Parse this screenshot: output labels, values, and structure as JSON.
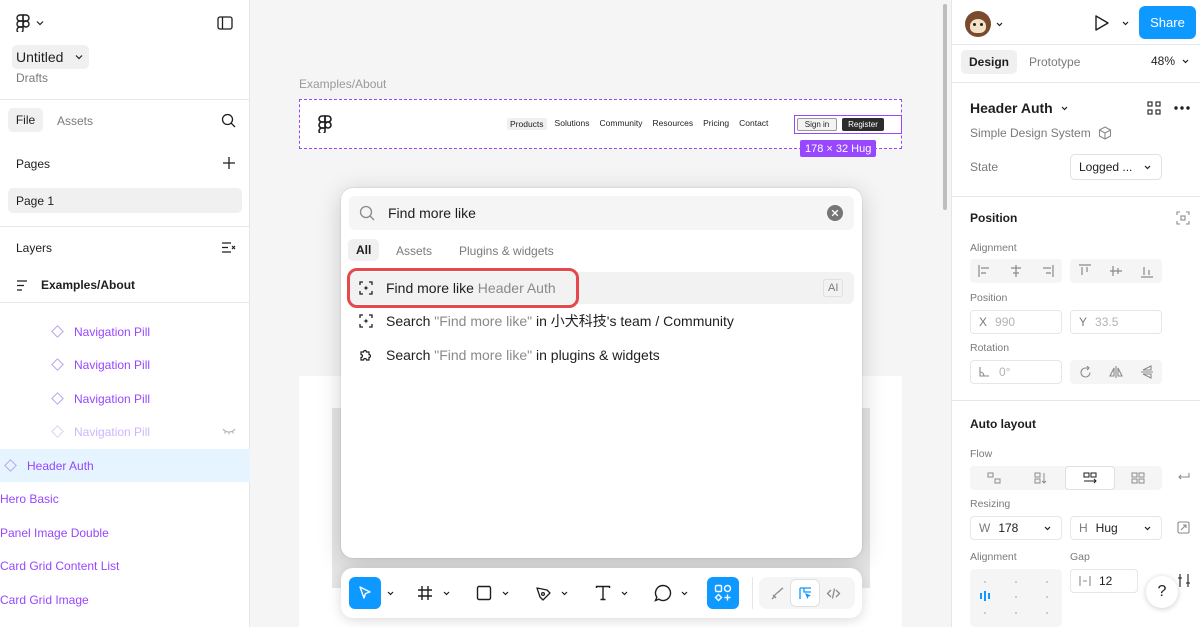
{
  "file": {
    "name": "Untitled",
    "location": "Drafts"
  },
  "left_tabs": {
    "file": "File",
    "assets": "Assets"
  },
  "pages": {
    "heading": "Pages",
    "items": [
      "Page 1"
    ]
  },
  "layers": {
    "heading": "Layers",
    "frame": "Examples/About",
    "children": [
      "Navigation Pill",
      "Navigation Pill",
      "Navigation Pill",
      "Navigation Pill"
    ],
    "selected": "Header Auth",
    "others": [
      "Hero Basic",
      "Panel Image Double",
      "Card Grid Content List",
      "Card Grid Image"
    ]
  },
  "canvas": {
    "frame_label": "Examples/About",
    "nav_links": [
      "Products",
      "Solutions",
      "Community",
      "Resources",
      "Pricing",
      "Contact"
    ],
    "sign_in": "Sign in",
    "register": "Register",
    "size_badge": "178 × 32 Hug"
  },
  "search_popup": {
    "query": "Find more like",
    "tabs": [
      "All",
      "Assets",
      "Plugins & widgets"
    ],
    "results": [
      {
        "prefix": "Find more like",
        "suffix": " Header Auth",
        "tail": "",
        "badge": "AI"
      },
      {
        "prefix": "Search ",
        "suffix": "\"Find more like\"",
        "tail": " in 小犬科技's team / Community",
        "badge": ""
      },
      {
        "prefix": "Search ",
        "suffix": "\"Find more like\"",
        "tail": " in plugins & widgets",
        "badge": ""
      }
    ]
  },
  "right_panel": {
    "share": "Share",
    "tabs": {
      "design": "Design",
      "prototype": "Prototype"
    },
    "zoom": "48%",
    "component": {
      "name": "Header Auth",
      "library": "Simple Design System",
      "state_label": "State",
      "state_value": "Logged ..."
    },
    "position": {
      "heading": "Position",
      "alignment_label": "Alignment",
      "position_label": "Position",
      "x_label": "X",
      "x_value": "990",
      "y_label": "Y",
      "y_value": "33.5",
      "rotation_label": "Rotation",
      "rotation_value": "0°"
    },
    "auto_layout": {
      "heading": "Auto layout",
      "flow_label": "Flow",
      "resizing_label": "Resizing",
      "w_label": "W",
      "w_value": "178",
      "h_label": "H",
      "h_value": "Hug",
      "alignment_label": "Alignment",
      "gap_label": "Gap",
      "gap_value": "12"
    },
    "help": "?"
  },
  "colors": {
    "accent": "#0d99ff",
    "component_purple": "#9747ff",
    "highlight_red": "#e5484d",
    "selected_row": "#e5f4ff"
  }
}
